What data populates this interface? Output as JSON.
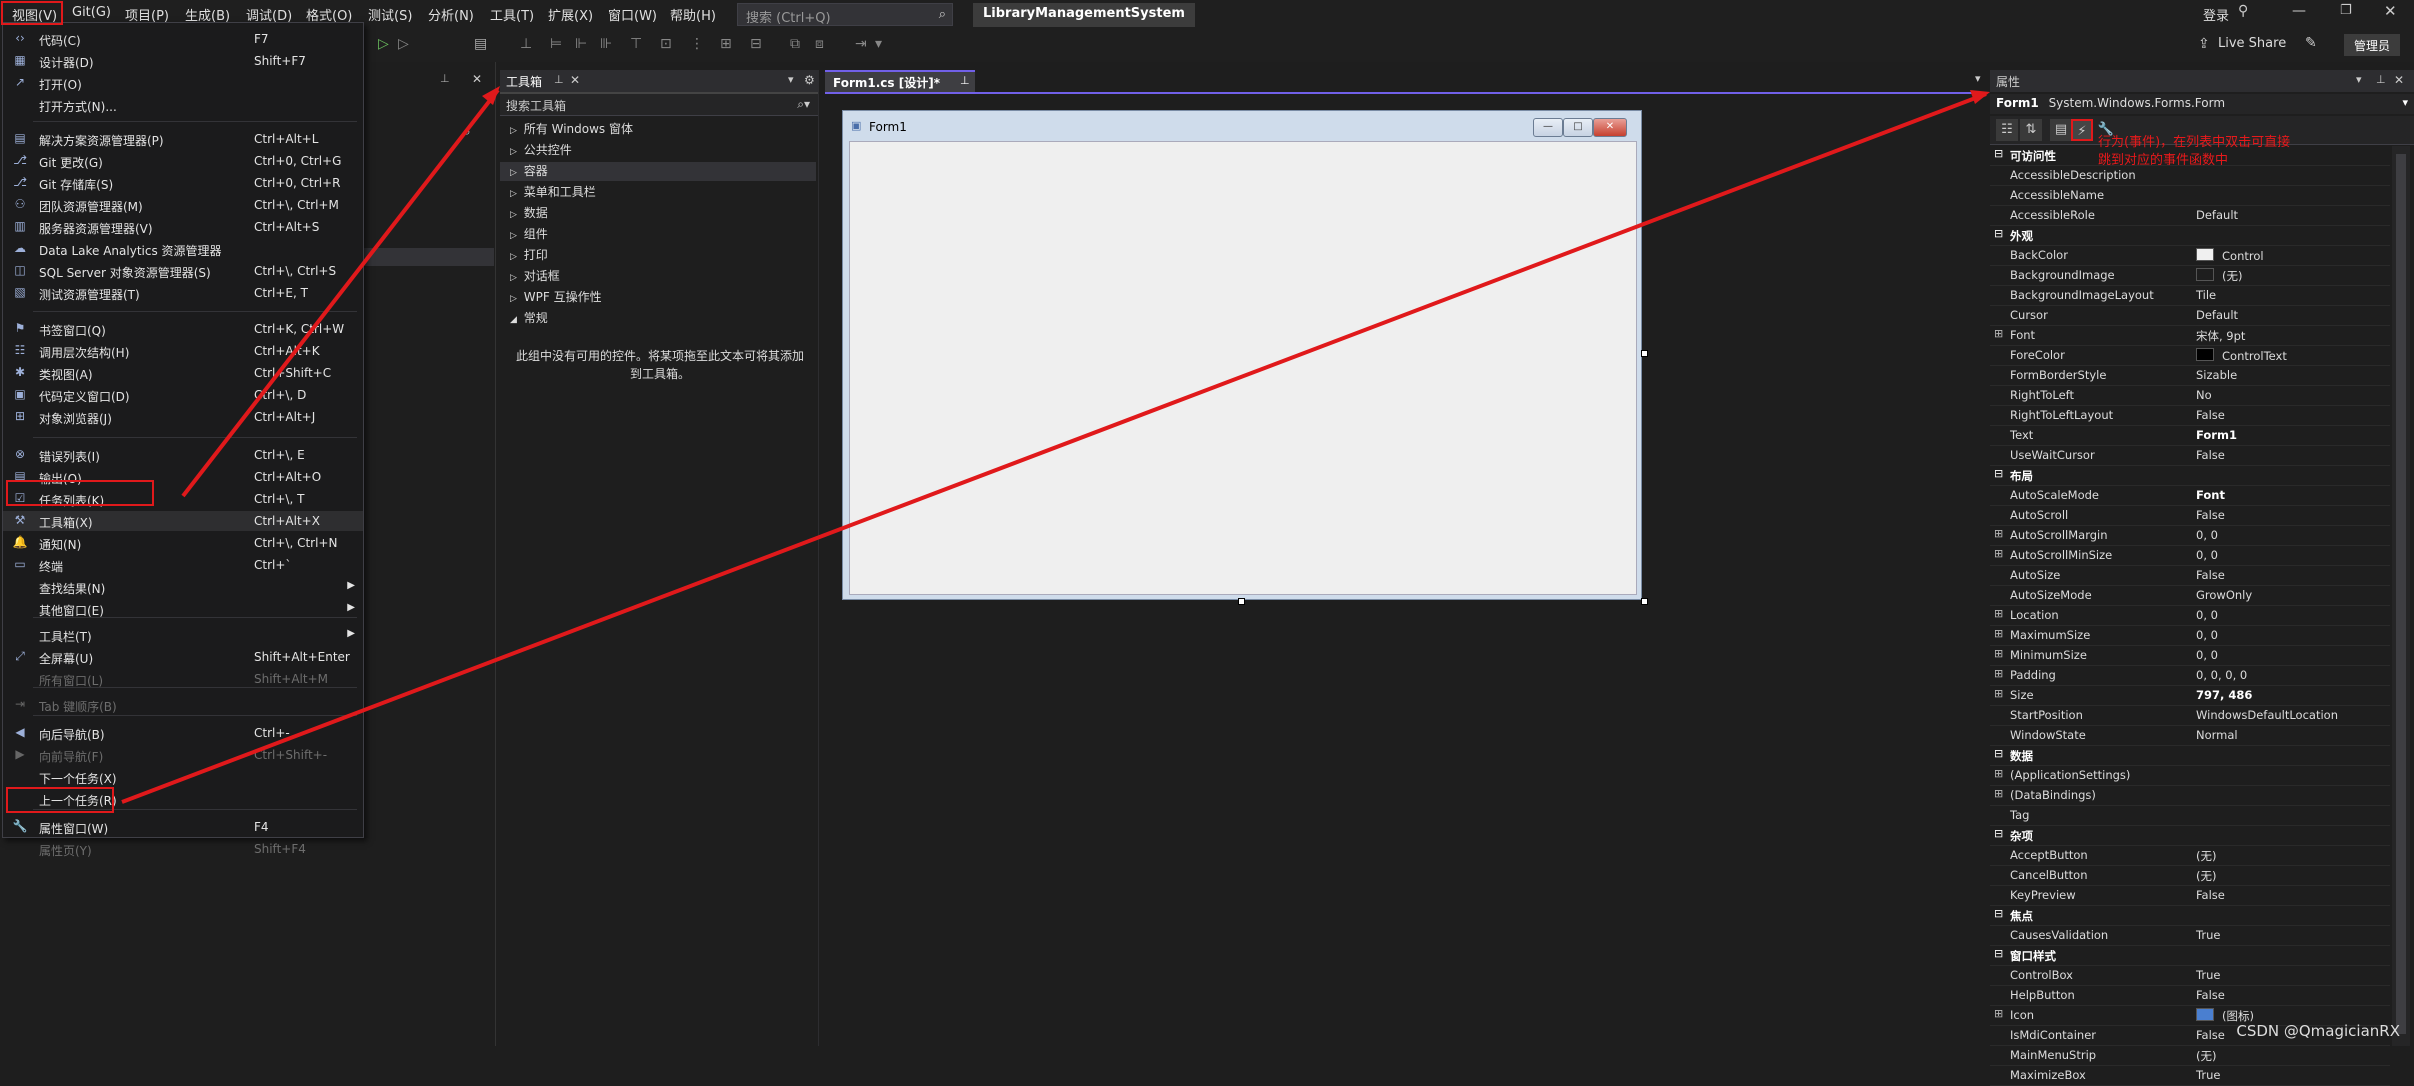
{
  "menubar": {
    "items": [
      "视图(V)",
      "Git(G)",
      "项目(P)",
      "生成(B)",
      "调试(D)",
      "格式(O)",
      "测试(S)",
      "分析(N)",
      "工具(T)",
      "扩展(X)",
      "窗口(W)",
      "帮助(H)"
    ],
    "search_placeholder": "搜索 (Ctrl+Q)",
    "project_name": "LibraryManagementSystem",
    "login": "登录",
    "live_share": "Live Share",
    "admin": "管理员"
  },
  "view_menu": {
    "items": [
      {
        "icon": "code-icon",
        "glyph": "‹›",
        "label": "代码(C)",
        "shortcut": "F7"
      },
      {
        "icon": "designer-icon",
        "glyph": "▦",
        "label": "设计器(D)",
        "shortcut": "Shift+F7"
      },
      {
        "icon": "open-icon",
        "glyph": "↗",
        "label": "打开(O)",
        "shortcut": ""
      },
      {
        "icon": "",
        "glyph": "",
        "label": "打开方式(N)...",
        "shortcut": ""
      },
      {
        "icon": "solution-explorer-icon",
        "glyph": "▤",
        "label": "解决方案资源管理器(P)",
        "shortcut": "Ctrl+Alt+L"
      },
      {
        "icon": "git-changes-icon",
        "glyph": "⎇",
        "label": "Git 更改(G)",
        "shortcut": "Ctrl+0, Ctrl+G"
      },
      {
        "icon": "git-repo-icon",
        "glyph": "⎇",
        "label": "Git 存储库(S)",
        "shortcut": "Ctrl+0, Ctrl+R"
      },
      {
        "icon": "team-explorer-icon",
        "glyph": "⚇",
        "label": "团队资源管理器(M)",
        "shortcut": "Ctrl+\\, Ctrl+M"
      },
      {
        "icon": "server-explorer-icon",
        "glyph": "▥",
        "label": "服务器资源管理器(V)",
        "shortcut": "Ctrl+Alt+S"
      },
      {
        "icon": "data-lake-icon",
        "glyph": "☁",
        "label": "Data Lake Analytics 资源管理器",
        "shortcut": ""
      },
      {
        "icon": "sql-server-icon",
        "glyph": "◫",
        "label": "SQL Server 对象资源管理器(S)",
        "shortcut": "Ctrl+\\, Ctrl+S"
      },
      {
        "icon": "test-explorer-icon",
        "glyph": "▧",
        "label": "测试资源管理器(T)",
        "shortcut": "Ctrl+E, T"
      },
      {
        "icon": "bookmark-icon",
        "glyph": "⚑",
        "label": "书签窗口(Q)",
        "shortcut": "Ctrl+K, Ctrl+W"
      },
      {
        "icon": "call-hierarchy-icon",
        "glyph": "☷",
        "label": "调用层次结构(H)",
        "shortcut": "Ctrl+Alt+K"
      },
      {
        "icon": "class-view-icon",
        "glyph": "✱",
        "label": "类视图(A)",
        "shortcut": "Ctrl+Shift+C"
      },
      {
        "icon": "code-definition-icon",
        "glyph": "▣",
        "label": "代码定义窗口(D)",
        "shortcut": "Ctrl+\\, D"
      },
      {
        "icon": "object-browser-icon",
        "glyph": "⊞",
        "label": "对象浏览器(J)",
        "shortcut": "Ctrl+Alt+J"
      },
      {
        "icon": "error-list-icon",
        "glyph": "⊗",
        "label": "错误列表(I)",
        "shortcut": "Ctrl+\\, E"
      },
      {
        "icon": "output-icon",
        "glyph": "▤",
        "label": "输出(O)",
        "shortcut": "Ctrl+Alt+O"
      },
      {
        "icon": "task-list-icon",
        "glyph": "☑",
        "label": "任务列表(K)",
        "shortcut": "Ctrl+\\, T"
      },
      {
        "icon": "toolbox-icon",
        "glyph": "⚒",
        "label": "工具箱(X)",
        "shortcut": "Ctrl+Alt+X"
      },
      {
        "icon": "notification-icon",
        "glyph": "🔔",
        "label": "通知(N)",
        "shortcut": "Ctrl+\\, Ctrl+N"
      },
      {
        "icon": "terminal-icon",
        "glyph": "▭",
        "label": "终端",
        "shortcut": "Ctrl+`"
      },
      {
        "icon": "",
        "glyph": "",
        "label": "查找结果(N)",
        "shortcut": ""
      },
      {
        "icon": "",
        "glyph": "",
        "label": "其他窗口(E)",
        "shortcut": ""
      },
      {
        "icon": "",
        "glyph": "",
        "label": "工具栏(T)",
        "shortcut": ""
      },
      {
        "icon": "fullscreen-icon",
        "glyph": "⤢",
        "label": "全屏幕(U)",
        "shortcut": "Shift+Alt+Enter"
      },
      {
        "icon": "",
        "glyph": "",
        "label": "所有窗口(L)",
        "shortcut": "Shift+Alt+M"
      },
      {
        "icon": "tab-order-icon",
        "glyph": "⇥",
        "label": "Tab 键顺序(B)",
        "shortcut": ""
      },
      {
        "icon": "navigate-back-icon",
        "glyph": "◀",
        "label": "向后导航(B)",
        "shortcut": "Ctrl+-"
      },
      {
        "icon": "navigate-forward-icon",
        "glyph": "▶",
        "label": "向前导航(F)",
        "shortcut": "Ctrl+Shift+-"
      },
      {
        "icon": "",
        "glyph": "",
        "label": "下一个任务(X)",
        "shortcut": ""
      },
      {
        "icon": "",
        "glyph": "",
        "label": "上一个任务(R)",
        "shortcut": ""
      },
      {
        "icon": "properties-window-icon",
        "glyph": "🔧",
        "label": "属性窗口(W)",
        "shortcut": "F4"
      },
      {
        "icon": "property-pages-icon",
        "glyph": "",
        "label": "属性页(Y)",
        "shortcut": "Shift+F4"
      }
    ]
  },
  "toolbox": {
    "title": "工具箱",
    "search_placeholder": "搜索工具箱",
    "categories": [
      "所有 Windows 窗体",
      "公共控件",
      "容器",
      "菜单和工具栏",
      "数据",
      "组件",
      "打印",
      "对话框",
      "WPF 互操作性",
      "常规"
    ],
    "empty_text": "此组中没有可用的控件。将某项拖至此文本可将其添加到工具箱。"
  },
  "designer": {
    "tab_label": "Form1.cs [设计]*",
    "form_title": "Form1"
  },
  "properties": {
    "title": "属性",
    "object_name": "Form1",
    "object_type": "System.Windows.Forms.Form",
    "annotation": "行为(事件)，在列表中双击可直接跳到对应的事件函数中",
    "rows": [
      {
        "category": true,
        "name": "可访问性"
      },
      {
        "name": "AccessibleDescription",
        "value": ""
      },
      {
        "name": "AccessibleName",
        "value": ""
      },
      {
        "name": "AccessibleRole",
        "value": "Default"
      },
      {
        "category": true,
        "name": "外观"
      },
      {
        "name": "BackColor",
        "value": "Control",
        "swatch": "#f0f0f0"
      },
      {
        "name": "BackgroundImage",
        "value": "(无)",
        "swatch": "#1e1e1e"
      },
      {
        "name": "BackgroundImageLayout",
        "value": "Tile"
      },
      {
        "name": "Cursor",
        "value": "Default"
      },
      {
        "name": "Font",
        "value": "宋体, 9pt",
        "expand": true
      },
      {
        "name": "ForeColor",
        "value": "ControlText",
        "swatch": "#000000"
      },
      {
        "name": "FormBorderStyle",
        "value": "Sizable"
      },
      {
        "name": "RightToLeft",
        "value": "No"
      },
      {
        "name": "RightToLeftLayout",
        "value": "False"
      },
      {
        "name": "Text",
        "value": "Form1",
        "bold": true
      },
      {
        "name": "UseWaitCursor",
        "value": "False"
      },
      {
        "category": true,
        "name": "布局"
      },
      {
        "name": "AutoScaleMode",
        "value": "Font",
        "bold": true
      },
      {
        "name": "AutoScroll",
        "value": "False"
      },
      {
        "name": "AutoScrollMargin",
        "value": "0, 0",
        "expand": true
      },
      {
        "name": "AutoScrollMinSize",
        "value": "0, 0",
        "expand": true
      },
      {
        "name": "AutoSize",
        "value": "False"
      },
      {
        "name": "AutoSizeMode",
        "value": "GrowOnly"
      },
      {
        "name": "Location",
        "value": "0, 0",
        "expand": true
      },
      {
        "name": "MaximumSize",
        "value": "0, 0",
        "expand": true
      },
      {
        "name": "MinimumSize",
        "value": "0, 0",
        "expand": true
      },
      {
        "name": "Padding",
        "value": "0, 0, 0, 0",
        "expand": true
      },
      {
        "name": "Size",
        "value": "797, 486",
        "expand": true,
        "bold": true
      },
      {
        "name": "StartPosition",
        "value": "WindowsDefaultLocation"
      },
      {
        "name": "WindowState",
        "value": "Normal"
      },
      {
        "category": true,
        "name": "数据"
      },
      {
        "name": "(ApplicationSettings)",
        "value": "",
        "expand": true
      },
      {
        "name": "(DataBindings)",
        "value": "",
        "expand": true
      },
      {
        "name": "Tag",
        "value": ""
      },
      {
        "category": true,
        "name": "杂项"
      },
      {
        "name": "AcceptButton",
        "value": "(无)"
      },
      {
        "name": "CancelButton",
        "value": "(无)"
      },
      {
        "name": "KeyPreview",
        "value": "False"
      },
      {
        "category": true,
        "name": "焦点"
      },
      {
        "name": "CausesValidation",
        "value": "True"
      },
      {
        "category": true,
        "name": "窗口样式"
      },
      {
        "name": "ControlBox",
        "value": "True"
      },
      {
        "name": "HelpButton",
        "value": "False"
      },
      {
        "name": "Icon",
        "value": "(图标)",
        "expand": true,
        "swatch": "#4a7fd0"
      },
      {
        "name": "IsMdiContainer",
        "value": "False"
      },
      {
        "name": "MainMenuStrip",
        "value": "(无)"
      },
      {
        "name": "MaximizeBox",
        "value": "True"
      }
    ]
  },
  "watermark": "CSDN @QmagicianRX",
  "colors": {
    "annotation_red": "#e0191b",
    "accent_purple": "#7160e8",
    "background": "#1e1e1e"
  }
}
